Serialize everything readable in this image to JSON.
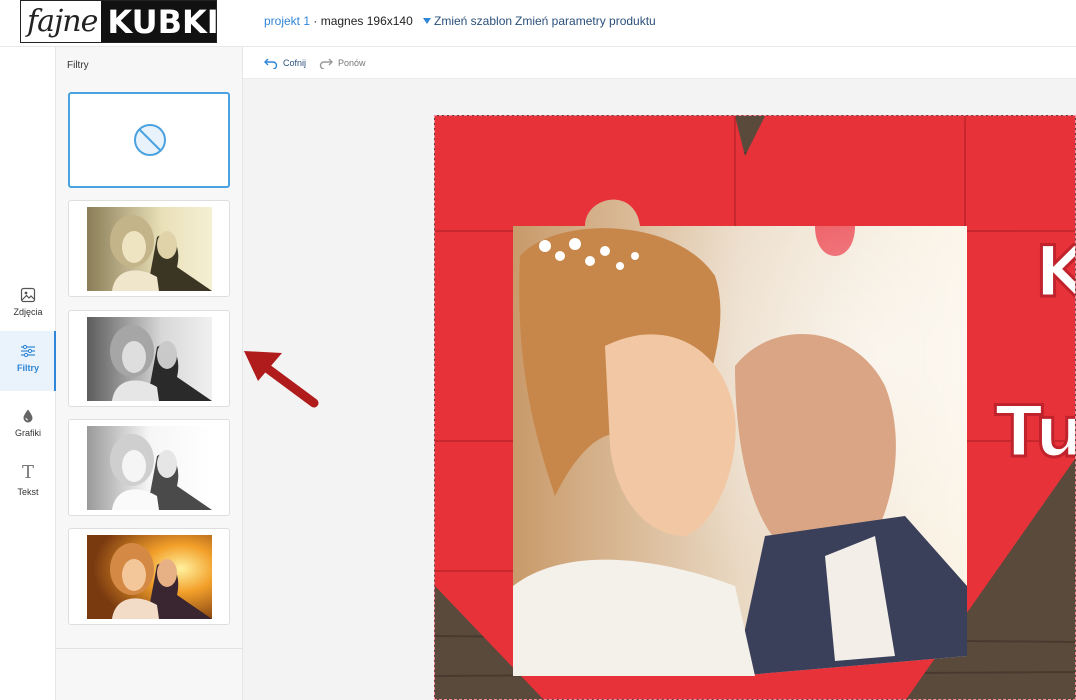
{
  "logo": {
    "script": "fajne",
    "bold": "KUBKI"
  },
  "header": {
    "project_name": "projekt 1",
    "separator": " · ",
    "product": "magnes 196x140",
    "change_template": "Zmień szablon",
    "change_params": "Zmień parametry produktu"
  },
  "rail": {
    "items": [
      {
        "label": "Zdjęcia",
        "icon": "image-icon"
      },
      {
        "label": "Filtry",
        "icon": "sliders-icon",
        "active": true
      },
      {
        "label": "Grafiki",
        "icon": "drop-icon"
      },
      {
        "label": "Tekst",
        "icon": "text-icon"
      }
    ]
  },
  "panel": {
    "title": "Filtry",
    "filters": [
      {
        "id": "none",
        "icon": "no-filter-icon"
      },
      {
        "id": "sepia"
      },
      {
        "id": "grayscale"
      },
      {
        "id": "bright-bw"
      },
      {
        "id": "warm"
      }
    ]
  },
  "toolbar": {
    "undo": "Cofnij",
    "redo": "Ponów"
  },
  "canvas": {
    "overlay_text_1": "K",
    "overlay_text_2": "Tu"
  },
  "colors": {
    "accent": "#2f86d6",
    "puzzle": "#e8323a",
    "arrow": "#b01c1c"
  }
}
